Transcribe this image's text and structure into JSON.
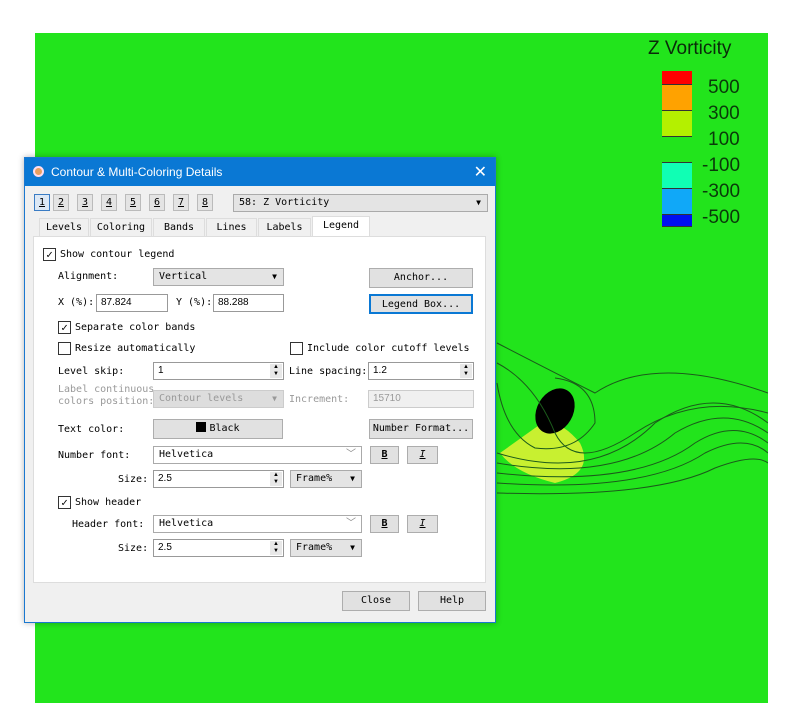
{
  "plot": {
    "legend_title": "Z Vorticity",
    "levels": [
      "500",
      "300",
      "100",
      "-100",
      "-300",
      "-500"
    ],
    "band_colors": [
      "#ff0000",
      "#ffa200",
      "#b4f000",
      "#22e41c",
      "#10ffb4",
      "#10a8f8",
      "#0010f0"
    ],
    "background": "#22e41c"
  },
  "dialog": {
    "title": "Contour & Multi-Coloring Details",
    "close_glyph": "✕",
    "group_buttons": [
      "1",
      "2",
      "3",
      "4",
      "5",
      "6",
      "7",
      "8"
    ],
    "variable": "58: Z Vorticity",
    "tabs": [
      "Levels",
      "Coloring",
      "Bands",
      "Lines",
      "Labels",
      "Legend"
    ],
    "show_contour_legend": "Show contour legend",
    "alignment_label": "Alignment:",
    "alignment_value": "Vertical",
    "anchor_button": "Anchor...",
    "x_label": "X (%):",
    "x_value": "87.824",
    "y_label": "Y (%):",
    "y_value": "88.288",
    "legend_box_button": "Legend Box...",
    "separate_color_bands": "Separate color bands",
    "resize_automatically": "Resize automatically",
    "include_cutoff": "Include color cutoff levels",
    "level_skip_label": "Level skip:",
    "level_skip_value": "1",
    "line_spacing_label": "Line spacing:",
    "line_spacing_value": "1.2",
    "label_continuous_1": "Label continuous",
    "label_continuous_2": "colors position:",
    "label_continuous_value": "Contour levels",
    "increment_label": "Increment:",
    "increment_value": "15710",
    "text_color_label": "Text color:",
    "text_color_value": "Black",
    "number_format_button": "Number Format...",
    "number_font_label": "Number font:",
    "number_font_value": "Helvetica",
    "bold": "B",
    "italic": "I",
    "size_label": "Size:",
    "number_size_value": "2.5",
    "size_unit": "Frame%",
    "show_header": "Show header",
    "header_font_label": "Header font:",
    "header_font_value": "Helvetica",
    "header_size_value": "2.5",
    "close_button": "Close",
    "help_button": "Help"
  }
}
